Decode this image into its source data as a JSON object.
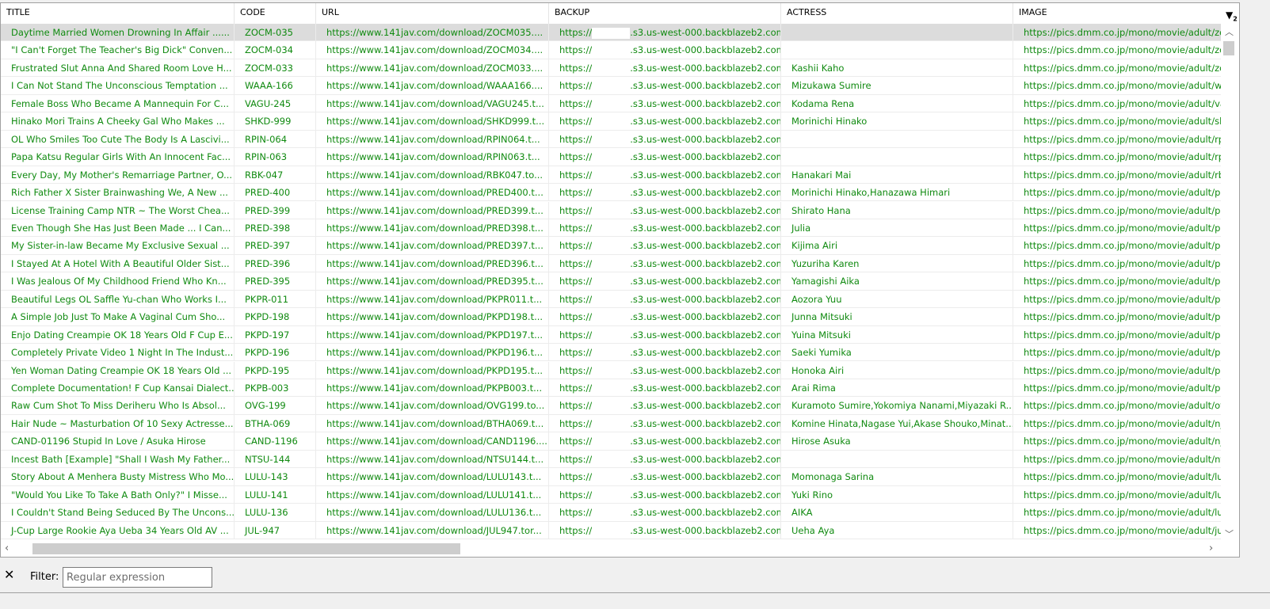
{
  "columns": [
    "TITLE",
    "CODE",
    "URL",
    "BACKUP",
    "ACTRESS",
    "IMAGE"
  ],
  "sort_indicator": "2",
  "backup_prefix": "https://",
  "backup_suffix": ".s3.us-west-000.backblazeb2.com...",
  "image_prefix": "https://pics.dmm.co.jp/mono/movie/adult/",
  "selected_row": 0,
  "rows": [
    {
      "title": "Daytime Married Women Drowning In Affair ......",
      "code": "ZOCM-035",
      "url": "https://www.141jav.com/download/ZOCM035....",
      "actress": "",
      "image": "zo"
    },
    {
      "title": "\"I Can't Forget The Teacher's Big Dick\" Conven...",
      "code": "ZOCM-034",
      "url": "https://www.141jav.com/download/ZOCM034....",
      "actress": "",
      "image": "zo"
    },
    {
      "title": "Frustrated Slut Anna And Shared Room Love H...",
      "code": "ZOCM-033",
      "url": "https://www.141jav.com/download/ZOCM033....",
      "actress": "Kashii Kaho",
      "image": "zo"
    },
    {
      "title": "I Can Not Stand The Unconscious Temptation ...",
      "code": "WAAA-166",
      "url": "https://www.141jav.com/download/WAAA166....",
      "actress": "Mizukawa Sumire",
      "image": "wa"
    },
    {
      "title": "Female Boss Who Became A Mannequin For C...",
      "code": "VAGU-245",
      "url": "https://www.141jav.com/download/VAGU245.t...",
      "actress": "Kodama Rena",
      "image": "va"
    },
    {
      "title": "Hinako Mori Trains A Cheeky Gal Who Makes ...",
      "code": "SHKD-999",
      "url": "https://www.141jav.com/download/SHKD999.t...",
      "actress": "Morinichi Hinako",
      "image": "sh"
    },
    {
      "title": "OL Who Smiles Too Cute The Body Is A Lascivi...",
      "code": "RPIN-064",
      "url": "https://www.141jav.com/download/RPIN064.t...",
      "actress": "",
      "image": "rp"
    },
    {
      "title": "Papa Katsu Regular Girls With An Innocent Fac...",
      "code": "RPIN-063",
      "url": "https://www.141jav.com/download/RPIN063.t...",
      "actress": "",
      "image": "rp"
    },
    {
      "title": "Every Day, My Mother's Remarriage Partner, O...",
      "code": "RBK-047",
      "url": "https://www.141jav.com/download/RBK047.to...",
      "actress": "Hanakari Mai",
      "image": "rb"
    },
    {
      "title": "Rich Father X Sister Brainwashing We, A New ...",
      "code": "PRED-400",
      "url": "https://www.141jav.com/download/PRED400.t...",
      "actress": "Morinichi Hinako,Hanazawa Himari",
      "image": "pr"
    },
    {
      "title": "License Training Camp NTR ~ The Worst Chea...",
      "code": "PRED-399",
      "url": "https://www.141jav.com/download/PRED399.t...",
      "actress": "Shirato Hana",
      "image": "pr"
    },
    {
      "title": "Even Though She Has Just Been Made ... I Can...",
      "code": "PRED-398",
      "url": "https://www.141jav.com/download/PRED398.t...",
      "actress": "Julia",
      "image": "pr"
    },
    {
      "title": "My Sister-in-law Became My Exclusive Sexual ...",
      "code": "PRED-397",
      "url": "https://www.141jav.com/download/PRED397.t...",
      "actress": "Kijima Airi",
      "image": "pr"
    },
    {
      "title": "I Stayed At A Hotel With A Beautiful Older Sist...",
      "code": "PRED-396",
      "url": "https://www.141jav.com/download/PRED396.t...",
      "actress": "Yuzuriha Karen",
      "image": "pr"
    },
    {
      "title": "I Was Jealous Of My Childhood Friend Who Kn...",
      "code": "PRED-395",
      "url": "https://www.141jav.com/download/PRED395.t...",
      "actress": "Yamagishi Aika",
      "image": "pr"
    },
    {
      "title": "Beautiful Legs OL Saffle Yu-chan Who Works I...",
      "code": "PKPR-011",
      "url": "https://www.141jav.com/download/PKPR011.t...",
      "actress": "Aozora Yuu",
      "image": "pk"
    },
    {
      "title": "A Simple Job Just To Make A Vaginal Cum Sho...",
      "code": "PKPD-198",
      "url": "https://www.141jav.com/download/PKPD198.t...",
      "actress": "Junna Mitsuki",
      "image": "pk"
    },
    {
      "title": "Enjo Dating Creampie OK 18 Years Old F Cup E...",
      "code": "PKPD-197",
      "url": "https://www.141jav.com/download/PKPD197.t...",
      "actress": "Yuina Mitsuki",
      "image": "pk"
    },
    {
      "title": "Completely Private Video 1 Night In The Indust...",
      "code": "PKPD-196",
      "url": "https://www.141jav.com/download/PKPD196.t...",
      "actress": "Saeki Yumika",
      "image": "pk"
    },
    {
      "title": "Yen Woman Dating Creampie OK 18 Years Old ...",
      "code": "PKPD-195",
      "url": "https://www.141jav.com/download/PKPD195.t...",
      "actress": "Honoka Airi",
      "image": "pk"
    },
    {
      "title": "Complete Documentation! F Cup Kansai Dialect...",
      "code": "PKPB-003",
      "url": "https://www.141jav.com/download/PKPB003.t...",
      "actress": "Arai Rima",
      "image": "pk"
    },
    {
      "title": "Raw Cum Shot To Miss Deriheru Who Is Absol...",
      "code": "OVG-199",
      "url": "https://www.141jav.com/download/OVG199.to...",
      "actress": "Kuramoto Sumire,Yokomiya Nanami,Miyazaki R...",
      "image": "ov"
    },
    {
      "title": "Hair Nude ~ Masturbation Of 10 Sexy Actresse...",
      "code": "BTHA-069",
      "url": "https://www.141jav.com/download/BTHA069.t...",
      "actress": "Komine Hinata,Nagase Yui,Akase Shouko,Minat...",
      "image": "n_"
    },
    {
      "title": "CAND-01196 Stupid In Love / Asuka Hirose",
      "code": "CAND-1196",
      "url": "https://www.141jav.com/download/CAND1196....",
      "actress": "Hirose Asuka",
      "image": "n_"
    },
    {
      "title": "Incest Bath [Example] \"Shall I Wash My Father...",
      "code": "NTSU-144",
      "url": "https://www.141jav.com/download/NTSU144.t...",
      "actress": "",
      "image": "nts"
    },
    {
      "title": "Story About A Menhera Busty Mistress Who Mo...",
      "code": "LULU-143",
      "url": "https://www.141jav.com/download/LULU143.t...",
      "actress": "Momonaga Sarina",
      "image": "lul"
    },
    {
      "title": "\"Would You Like To Take A Bath Only?\" I Misse...",
      "code": "LULU-141",
      "url": "https://www.141jav.com/download/LULU141.t...",
      "actress": "Yuki Rino",
      "image": "lul"
    },
    {
      "title": "I Couldn't Stand Being Seduced By The Uncons...",
      "code": "LULU-136",
      "url": "https://www.141jav.com/download/LULU136.t...",
      "actress": "AIKA",
      "image": "lul"
    },
    {
      "title": "J-Cup Large Rookie Aya Ueba 34 Years Old AV ...",
      "code": "JUL-947",
      "url": "https://www.141jav.com/download/JUL947.tor...",
      "actress": "Ueha Aya",
      "image": "jul"
    }
  ],
  "filter": {
    "label": "Filter:",
    "placeholder": "Regular expression",
    "value": ""
  },
  "colors": {
    "text": "#108a10",
    "selected": "#dcdcdc",
    "scroll_thumb": "#cdcdcd"
  }
}
